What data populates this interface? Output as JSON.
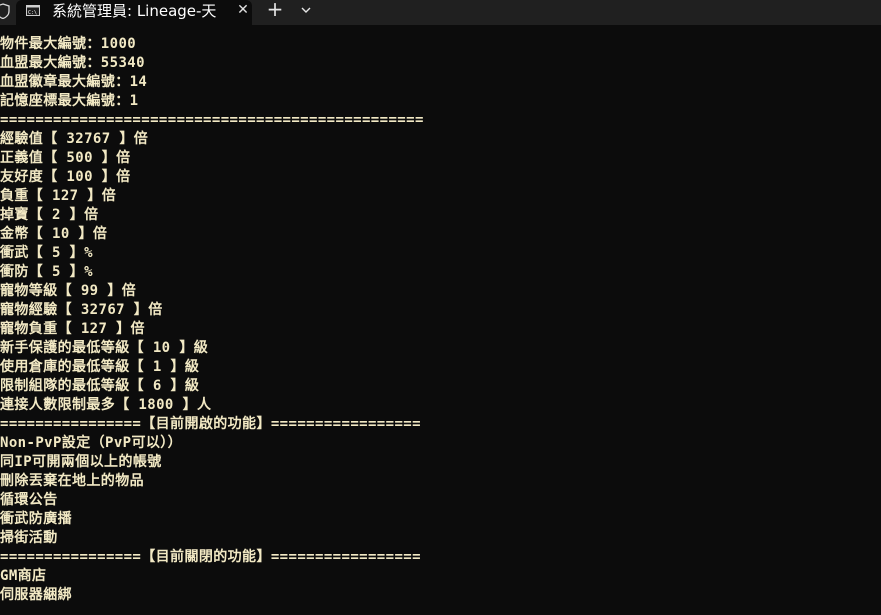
{
  "tab": {
    "title": "系統管理員:  Lineage-天",
    "close_icon": "close-icon",
    "new_tab_icon": "plus-icon",
    "dropdown_icon": "chevron-down-icon"
  },
  "colors": {
    "console_background": "#0c0c0c",
    "console_text": "#f2e9c4",
    "titlebar": "#202020"
  },
  "console": {
    "lines": [
      "物件最大編號：1000",
      "血盟最大編號：55340",
      "血盟徽章最大編號：14",
      "記憶座標最大編號：1",
      "================================================",
      "經驗值【 32767 】倍",
      "正義值【 500 】倍",
      "友好度【 100 】倍",
      "負重【 127 】倍",
      "掉寶【 2 】倍",
      "金幣【 10 】倍",
      "衝武【 5 】%",
      "衝防【 5 】%",
      "寵物等級【 99 】倍",
      "寵物經驗【 32767 】倍",
      "寵物負重【 127 】倍",
      "新手保護的最低等級【 10 】級",
      "使用倉庫的最低等級【 1 】級",
      "限制組隊的最低等級【 6 】級",
      "連接人數限制最多【 1800 】人",
      "================【目前開啟的功能】=================",
      "Non-PvP設定（PvP可以））",
      "同IP可開兩個以上的帳號",
      "刪除丟棄在地上的物品",
      "循環公告",
      "衝武防廣播",
      "掃街活動",
      "================【目前關閉的功能】=================",
      "GM商店",
      "伺服器綑綁"
    ]
  }
}
